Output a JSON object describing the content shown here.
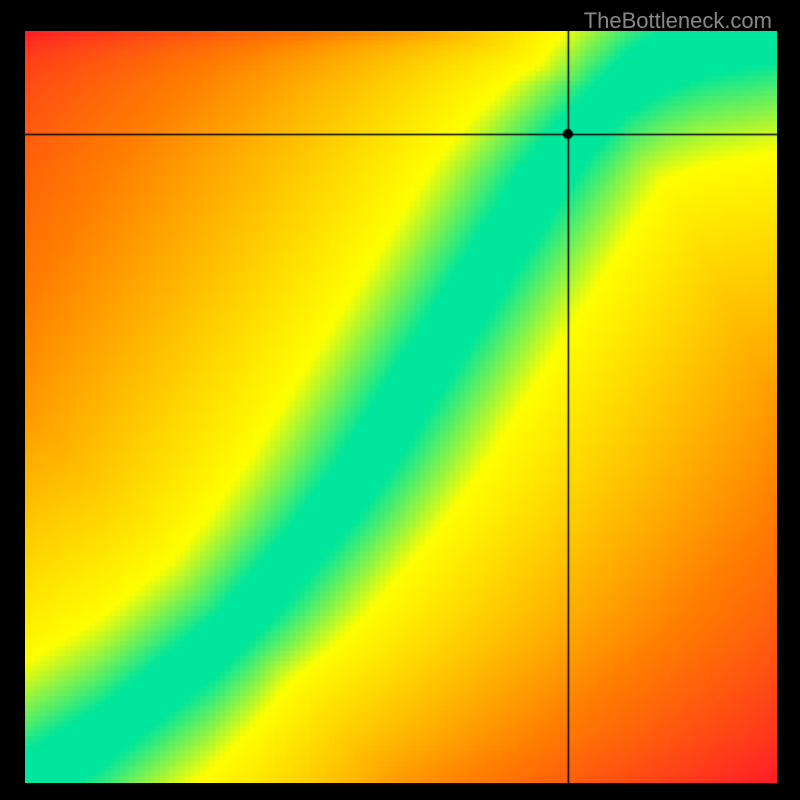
{
  "watermark": "TheBottleneck.com",
  "chart_data": {
    "type": "heatmap",
    "title": "",
    "xlabel": "",
    "ylabel": "",
    "x_range": [
      0,
      1
    ],
    "y_range": [
      0,
      1
    ],
    "colorscale": [
      "#ff0033",
      "#ff8000",
      "#ffff00",
      "#00e69c"
    ],
    "value_range": [
      0,
      1
    ],
    "optimal_curve_xy": [
      [
        0.0,
        0.0
      ],
      [
        0.05,
        0.03
      ],
      [
        0.1,
        0.06
      ],
      [
        0.15,
        0.1
      ],
      [
        0.2,
        0.14
      ],
      [
        0.25,
        0.18
      ],
      [
        0.3,
        0.23
      ],
      [
        0.35,
        0.29
      ],
      [
        0.4,
        0.35
      ],
      [
        0.45,
        0.42
      ],
      [
        0.5,
        0.5
      ],
      [
        0.55,
        0.58
      ],
      [
        0.6,
        0.66
      ],
      [
        0.65,
        0.74
      ],
      [
        0.7,
        0.82
      ],
      [
        0.75,
        0.88
      ],
      [
        0.8,
        0.93
      ],
      [
        0.85,
        0.96
      ],
      [
        0.9,
        0.98
      ],
      [
        0.95,
        0.99
      ],
      [
        1.0,
        1.0
      ]
    ],
    "band_half_width_normalized": 0.04,
    "crosshair": {
      "x": 0.722,
      "y": 0.863
    },
    "marker": {
      "x": 0.722,
      "y": 0.863,
      "radius_px": 5
    },
    "description": "2D heatmap (bottleneck chart). Green band is the optimal pairing curve; color transitions green→yellow→orange→red with distance from the curve. Crosshair lines meet at the marker point."
  }
}
